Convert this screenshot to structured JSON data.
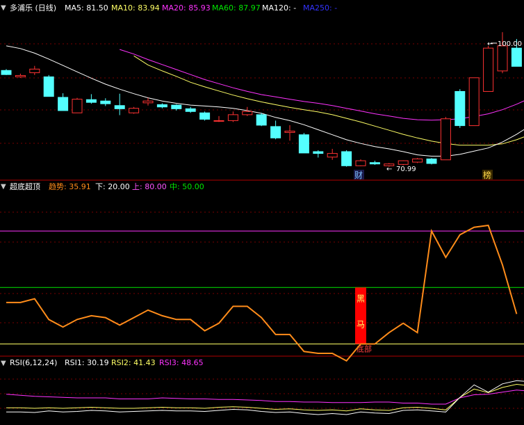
{
  "colors": {
    "bg": "#000000",
    "up": "#ff3232",
    "down": "#54ffff",
    "grid": "#7a0000",
    "white": "#ffffff",
    "yellow": "#ffff66",
    "magenta": "#ff33ff",
    "green": "#00e600",
    "blue": "#3333ff",
    "orange": "#ff8c1a",
    "pink": "#ff55ff",
    "label": "#c8c8c8",
    "gold": "#ffd94a"
  },
  "main_header": {
    "icon": "chevron-down-icon",
    "title": "多浦乐 (日线)",
    "ma5": "MA5: 81.50",
    "ma10": "MA10: 83.94",
    "ma20": "MA20: 85.93",
    "ma60": "MA60: 87.97",
    "ma120": "MA120: -",
    "ma250": "MA250: -"
  },
  "ind_header": {
    "icon": "chevron-down-icon",
    "title": "超底超顶",
    "trend": "趋势: 35.91",
    "lower": "下: 20.00",
    "upper": "上: 80.00",
    "mid": "中: 50.00"
  },
  "rsi_header": {
    "icon": "chevron-down-icon",
    "title": "RSI(6,12,24)",
    "rsi1": "RSI1: 30.19",
    "rsi2": "RSI2: 41.43",
    "rsi3": "RSI3: 48.65"
  },
  "annotations": {
    "high_label": "100.00",
    "low_label": "70.99",
    "fin_badge": "财",
    "rank_badge": "榜",
    "signal_chars": [
      "黑",
      "马"
    ],
    "signal_bottom": "底部"
  },
  "chart_data": [
    {
      "type": "candlestick",
      "y_range": [
        68,
        104
      ],
      "candles": [
        {
          "o": 91.6,
          "c": 90.7,
          "h": 91.9,
          "l": 90.6
        },
        {
          "o": 90.2,
          "c": 90.5,
          "h": 90.9,
          "l": 90.0
        },
        {
          "o": 91.1,
          "c": 91.9,
          "h": 92.6,
          "l": 90.6
        },
        {
          "o": 90.2,
          "c": 85.9,
          "h": 90.6,
          "l": 85.9
        },
        {
          "o": 85.7,
          "c": 82.8,
          "h": 86.6,
          "l": 82.8
        },
        {
          "o": 82.3,
          "c": 85.3,
          "h": 85.6,
          "l": 82.3
        },
        {
          "o": 85.2,
          "c": 84.6,
          "h": 86.4,
          "l": 84.3
        },
        {
          "o": 84.9,
          "c": 84.3,
          "h": 85.5,
          "l": 83.8
        },
        {
          "o": 83.9,
          "c": 83.2,
          "h": 86.5,
          "l": 81.8
        },
        {
          "o": 82.3,
          "c": 83.3,
          "h": 83.6,
          "l": 82.1
        },
        {
          "o": 84.5,
          "c": 84.9,
          "h": 85.6,
          "l": 83.9
        },
        {
          "o": 84.1,
          "c": 83.6,
          "h": 84.4,
          "l": 83.3
        },
        {
          "o": 84.0,
          "c": 83.2,
          "h": 84.2,
          "l": 82.8
        },
        {
          "o": 83.2,
          "c": 82.6,
          "h": 83.6,
          "l": 82.3
        },
        {
          "o": 82.3,
          "c": 80.9,
          "h": 82.6,
          "l": 80.6
        },
        {
          "o": 80.6,
          "c": 80.6,
          "h": 81.6,
          "l": 80.3
        },
        {
          "o": 80.6,
          "c": 81.9,
          "h": 82.6,
          "l": 80.3
        },
        {
          "o": 81.9,
          "c": 82.6,
          "h": 83.6,
          "l": 81.6
        },
        {
          "o": 81.9,
          "c": 79.6,
          "h": 82.3,
          "l": 79.4
        },
        {
          "o": 79.3,
          "c": 76.8,
          "h": 80.6,
          "l": 76.5
        },
        {
          "o": 78.0,
          "c": 78.3,
          "h": 79.6,
          "l": 76.2
        },
        {
          "o": 77.5,
          "c": 73.5,
          "h": 77.9,
          "l": 73.5
        },
        {
          "o": 73.8,
          "c": 73.4,
          "h": 74.1,
          "l": 72.5
        },
        {
          "o": 72.6,
          "c": 73.4,
          "h": 74.4,
          "l": 72.0
        },
        {
          "o": 73.8,
          "c": 70.7,
          "h": 74.1,
          "l": 70.5
        },
        {
          "o": 70.7,
          "c": 71.8,
          "h": 72.1,
          "l": 70.6
        },
        {
          "o": 71.4,
          "c": 71.1,
          "h": 71.8,
          "l": 70.9
        },
        {
          "o": 70.7,
          "c": 71.1,
          "h": 71.3,
          "l": 70.5
        },
        {
          "o": 71.0,
          "c": 71.8,
          "h": 71.9,
          "l": 70.8
        },
        {
          "o": 71.5,
          "c": 72.2,
          "h": 72.4,
          "l": 71.3
        },
        {
          "o": 72.2,
          "c": 71.2,
          "h": 72.4,
          "l": 71.0
        },
        {
          "o": 72.0,
          "c": 81.0,
          "h": 81.4,
          "l": 72.0
        },
        {
          "o": 87.0,
          "c": 79.5,
          "h": 87.5,
          "l": 79.0
        },
        {
          "o": 79.5,
          "c": 90.0,
          "h": 90.0,
          "l": 79.5
        },
        {
          "o": 87.0,
          "c": 96.5,
          "h": 97.0,
          "l": 87.0
        },
        {
          "o": 91.5,
          "c": 97.0,
          "h": 100.0,
          "l": 91.0
        },
        {
          "o": 96.5,
          "c": 92.5,
          "h": 98.5,
          "l": 92.5
        },
        {
          "o": 92.0,
          "c": 93.0,
          "h": 94.5,
          "l": 91.5
        }
      ],
      "ma5": [
        null,
        null,
        null,
        null,
        null,
        null,
        null,
        null,
        null,
        null,
        null,
        null,
        null,
        null,
        null,
        null,
        null,
        null,
        82.6,
        81.8,
        80.4,
        79.7,
        78.5,
        77.8,
        76.9,
        75.4,
        74.6,
        74.0,
        72.9,
        72.6,
        72.0,
        72.0,
        72.5,
        74.0,
        76.0,
        79.7,
        84.0,
        88.1
      ],
      "ma10": [
        97.0,
        96.4,
        95.4,
        94.1,
        92.7,
        91.3,
        89.9,
        88.6,
        87.5,
        86.5,
        85.6,
        84.9,
        84.4,
        84.0,
        83.8,
        83.6,
        83.3,
        82.8,
        82.2,
        81.3,
        80.6,
        79.7,
        78.6,
        77.5,
        76.4,
        75.6,
        74.9,
        74.4,
        73.8,
        73.1,
        72.8,
        72.8,
        73.2,
        73.9,
        74.6,
        75.9,
        77.6,
        79.6
      ],
      "ma20": [
        null,
        null,
        null,
        null,
        null,
        null,
        null,
        null,
        null,
        94.8,
        92.8,
        91.5,
        90.3,
        89.0,
        88.0,
        87.1,
        86.2,
        85.4,
        84.7,
        84.1,
        83.5,
        83.0,
        82.5,
        81.9,
        81.1,
        80.3,
        79.4,
        78.5,
        77.6,
        76.8,
        76.1,
        75.6,
        75.2,
        75.2,
        75.2,
        75.5,
        76.4,
        77.6
      ],
      "ma60": [
        null,
        null,
        null,
        null,
        null,
        null,
        null,
        null,
        96.2,
        95.2,
        94.0,
        92.9,
        91.8,
        90.7,
        89.6,
        88.7,
        87.8,
        87.0,
        86.3,
        85.8,
        85.3,
        84.8,
        84.4,
        83.9,
        83.3,
        82.7,
        82.1,
        81.6,
        81.1,
        80.8,
        80.7,
        80.8,
        81.0,
        81.5,
        82.1,
        83.0,
        84.2,
        85.6
      ]
    },
    {
      "type": "line",
      "title": "超底超顶",
      "y_range": [
        15,
        100
      ],
      "reference_lines": {
        "lower": 20,
        "mid": 50,
        "upper": 80
      },
      "series": [
        {
          "name": "趋势",
          "values": [
            42,
            42,
            44,
            33,
            29,
            33,
            35,
            34,
            30,
            34,
            38,
            35,
            33,
            33,
            27,
            31,
            40,
            40,
            34,
            25,
            25,
            16,
            15,
            15,
            11,
            20,
            20,
            26,
            31,
            26,
            80,
            66,
            78,
            82,
            83,
            62,
            35.91
          ]
        }
      ],
      "signal": {
        "index": 25,
        "from": 20,
        "to": 50,
        "labels": [
          "黑",
          "马"
        ],
        "bottom_label": "底部"
      }
    },
    {
      "type": "line",
      "title": "RSI(6,12,24)",
      "y_range": [
        0,
        100
      ],
      "series": [
        {
          "name": "RSI1",
          "values": [
            17,
            17,
            16,
            19,
            17,
            18,
            20,
            19,
            17,
            18,
            19,
            20,
            19,
            19,
            18,
            20,
            22,
            21,
            18,
            16,
            17,
            14,
            12,
            14,
            12,
            17,
            15,
            14,
            20,
            21,
            19,
            17,
            45,
            69,
            55,
            71,
            77,
            75,
            30
          ]
        },
        {
          "name": "RSI2",
          "values": [
            25,
            25,
            24,
            25,
            24,
            25,
            26,
            25,
            24,
            24,
            25,
            26,
            25,
            25,
            24,
            26,
            27,
            26,
            24,
            22,
            23,
            21,
            20,
            21,
            19,
            23,
            21,
            20,
            25,
            26,
            24,
            21,
            45,
            61,
            54,
            64,
            70,
            67,
            41
          ]
        },
        {
          "name": "RSI3",
          "values": [
            51,
            49,
            47,
            46,
            45,
            44,
            44,
            44,
            42,
            42,
            42,
            44,
            43,
            42,
            42,
            41,
            41,
            40,
            39,
            37,
            37,
            36,
            36,
            35,
            35,
            35,
            36,
            36,
            34,
            34,
            32,
            32,
            44,
            50,
            51,
            55,
            59,
            57,
            49
          ]
        }
      ]
    }
  ]
}
